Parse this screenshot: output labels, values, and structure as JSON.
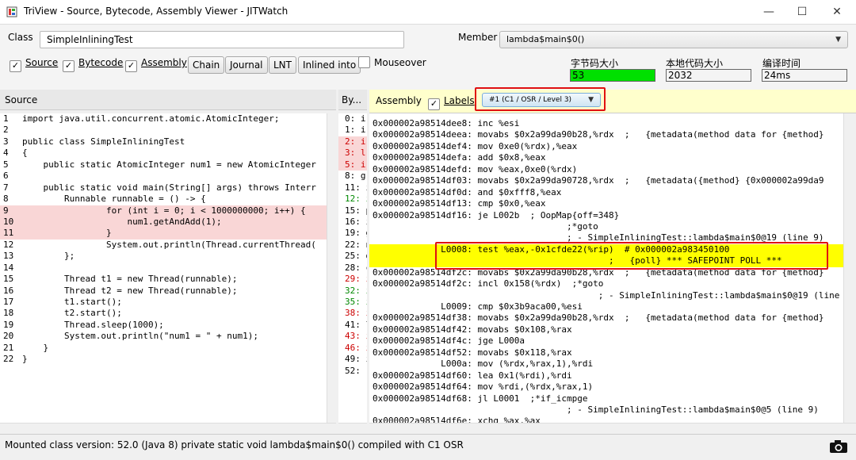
{
  "window": {
    "title": "TriView - Source, Bytecode, Assembly Viewer - JITWatch",
    "minimize": "—",
    "maximize": "☐",
    "close": "✕"
  },
  "toolbar": {
    "class_label": "Class",
    "class_value": "SimpleInliningTest",
    "member_label": "Member",
    "member_value": "lambda$main$0()",
    "checkboxes": [
      {
        "label": "Source",
        "checked": true
      },
      {
        "label": "Bytecode",
        "checked": true
      },
      {
        "label": "Assembly",
        "checked": true
      }
    ],
    "buttons": [
      "Chain",
      "Journal",
      "LNT",
      "Inlined into"
    ],
    "mouseover_label": "Mouseover",
    "mouseover_checked": false,
    "stats": [
      {
        "label": "字节码大小",
        "value": "53",
        "color": "#00e000"
      },
      {
        "label": "本地代码大小",
        "value": "2032",
        "color": "#f0f0f0"
      },
      {
        "label": "编译时间",
        "value": "24ms",
        "color": "#f0f0f0"
      }
    ]
  },
  "panes": {
    "source_title": "Source",
    "bytecode_title": "By...",
    "assembly_title": "Assembly",
    "labels_label": "Labels",
    "labels_checked": true,
    "compile_select": "#1  (C1 / OSR / Level 3)"
  },
  "source_lines": [
    {
      "n": "1",
      "t": "import java.util.concurrent.atomic.AtomicInteger;",
      "h": false
    },
    {
      "n": "2",
      "t": "",
      "h": false
    },
    {
      "n": "3",
      "t": "public class SimpleInliningTest",
      "h": false
    },
    {
      "n": "4",
      "t": "{",
      "h": false
    },
    {
      "n": "5",
      "t": "    public static AtomicInteger num1 = new AtomicInteger",
      "h": false
    },
    {
      "n": "6",
      "t": "",
      "h": false
    },
    {
      "n": "7",
      "t": "    public static void main(String[] args) throws Interr",
      "h": false
    },
    {
      "n": "8",
      "t": "        Runnable runnable = () -> {",
      "h": false
    },
    {
      "n": "9",
      "t": "                for (int i = 0; i < 1000000000; i++) {",
      "h": true
    },
    {
      "n": "10",
      "t": "                    num1.getAndAdd(1);",
      "h": true
    },
    {
      "n": "11",
      "t": "                }",
      "h": true
    },
    {
      "n": "12",
      "t": "                System.out.println(Thread.currentThread(",
      "h": false
    },
    {
      "n": "13",
      "t": "        };",
      "h": false
    },
    {
      "n": "14",
      "t": "",
      "h": false
    },
    {
      "n": "15",
      "t": "        Thread t1 = new Thread(runnable);",
      "h": false
    },
    {
      "n": "16",
      "t": "        Thread t2 = new Thread(runnable);",
      "h": false
    },
    {
      "n": "17",
      "t": "        t1.start();",
      "h": false
    },
    {
      "n": "18",
      "t": "        t2.start();",
      "h": false
    },
    {
      "n": "19",
      "t": "        Thread.sleep(1000);",
      "h": false
    },
    {
      "n": "20",
      "t": "        System.out.println(\"num1 = \" + num1);",
      "h": false
    },
    {
      "n": "21",
      "t": "    }",
      "h": false
    },
    {
      "n": "22",
      "t": "}",
      "h": false
    }
  ],
  "bytecode_lines": [
    {
      "t": "0: i",
      "c": "",
      "h": false
    },
    {
      "t": "1: i",
      "c": "",
      "h": false
    },
    {
      "t": "2: i",
      "c": "red",
      "h": true
    },
    {
      "t": "3: l",
      "c": "red",
      "h": true
    },
    {
      "t": "5: i",
      "c": "red",
      "h": true
    },
    {
      "t": "8: g",
      "c": "",
      "h": false
    },
    {
      "t": "11: i",
      "c": "",
      "h": false
    },
    {
      "t": "12: i",
      "c": "green",
      "h": false
    },
    {
      "t": "15: p",
      "c": "",
      "h": false
    },
    {
      "t": "16: i",
      "c": "",
      "h": false
    },
    {
      "t": "19: g",
      "c": "",
      "h": false
    },
    {
      "t": "22: n",
      "c": "",
      "h": false
    },
    {
      "t": "25: d",
      "c": "",
      "h": false
    },
    {
      "t": "28: c",
      "c": "",
      "h": false
    },
    {
      "t": "29: i",
      "c": "red",
      "h": false
    },
    {
      "t": "32: i",
      "c": "green",
      "h": false
    },
    {
      "t": "35: i",
      "c": "green",
      "h": false
    },
    {
      "t": "38: i",
      "c": "red",
      "h": false
    },
    {
      "t": "41: l",
      "c": "",
      "h": false
    },
    {
      "t": "43: i",
      "c": "red",
      "h": false
    },
    {
      "t": "46: i",
      "c": "red",
      "h": false
    },
    {
      "t": "49: i",
      "c": "",
      "h": false
    },
    {
      "t": "52: r",
      "c": "",
      "h": false
    }
  ],
  "assembly_lines": [
    {
      "t": "0x000002a98514dee8: inc %esi",
      "y": false
    },
    {
      "t": "0x000002a98514deea: movabs $0x2a99da90b28,%rdx  ;   {metadata(method data for {method}",
      "y": false
    },
    {
      "t": "0x000002a98514def4: mov 0xe0(%rdx),%eax",
      "y": false
    },
    {
      "t": "0x000002a98514defa: add $0x8,%eax",
      "y": false
    },
    {
      "t": "0x000002a98514defd: mov %eax,0xe0(%rdx)",
      "y": false
    },
    {
      "t": "0x000002a98514df03: movabs $0x2a99da90728,%rdx  ;   {metadata({method} {0x000002a99da9",
      "y": false
    },
    {
      "t": "0x000002a98514df0d: and $0xfff8,%eax",
      "y": false
    },
    {
      "t": "0x000002a98514df13: cmp $0x0,%eax",
      "y": false
    },
    {
      "t": "0x000002a98514df16: je L002b  ; OopMap{off=348}",
      "y": false
    },
    {
      "t": "                                     ;*goto",
      "y": false
    },
    {
      "t": "                                     ; - SimpleInliningTest::lambda$main$0@19 (line 9)",
      "y": false
    },
    {
      "t": "             L0008: test %eax,-0x1cfde22(%rip)  # 0x000002a983450100",
      "y": true
    },
    {
      "t": "                                             ;   {poll} *** SAFEPOINT POLL ***",
      "y": true
    },
    {
      "t": "0x000002a98514df2c: movabs $0x2a99da90b28,%rdx  ;   {metadata(method data for {method}",
      "y": false
    },
    {
      "t": "0x000002a98514df2c: incl 0x158(%rdx)  ;*goto",
      "y": false
    },
    {
      "t": "                                           ; - SimpleInliningTest::lambda$main$0@19 (line 9",
      "y": false
    },
    {
      "t": "             L0009: cmp $0x3b9aca00,%esi",
      "y": false
    },
    {
      "t": "0x000002a98514df38: movabs $0x2a99da90b28,%rdx  ;   {metadata(method data for {method}",
      "y": false
    },
    {
      "t": "0x000002a98514df42: movabs $0x108,%rax",
      "y": false
    },
    {
      "t": "0x000002a98514df4c: jge L000a",
      "y": false
    },
    {
      "t": "0x000002a98514df52: movabs $0x118,%rax",
      "y": false
    },
    {
      "t": "             L000a: mov (%rdx,%rax,1),%rdi",
      "y": false
    },
    {
      "t": "0x000002a98514df60: lea 0x1(%rdi),%rdi",
      "y": false
    },
    {
      "t": "0x000002a98514df64: mov %rdi,(%rdx,%rax,1)",
      "y": false
    },
    {
      "t": "0x000002a98514df68: jl L0001  ;*if_icmpge",
      "y": false
    },
    {
      "t": "                                     ; - SimpleInliningTest::lambda$main$0@5 (line 9)",
      "y": false
    },
    {
      "t": "0x000002a98514df6e: xchg %ax,%ax",
      "y": false
    }
  ],
  "status": {
    "text": "Mounted class version: 52.0 (Java 8) private static void lambda$main$0() compiled with C1 OSR"
  }
}
